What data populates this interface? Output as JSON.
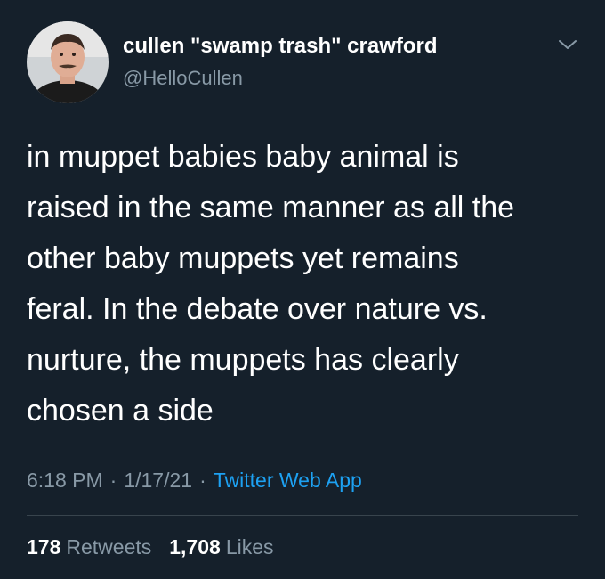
{
  "tweet": {
    "author": {
      "display_name": "cullen \"swamp trash\" crawford",
      "handle": "@HelloCullen",
      "avatar_icon": "user-avatar"
    },
    "menu_icon": "chevron-down-icon",
    "text_lines": [
      "in muppet babies baby animal is",
      "raised in the same manner as all the",
      "other baby muppets yet remains",
      "feral. In the debate over nature vs.",
      "nurture, the muppets has clearly",
      "chosen a side"
    ],
    "time": "6:18 PM",
    "date": "1/17/21",
    "separator": "·",
    "source": "Twitter Web App",
    "retweets": {
      "count": "178",
      "label": "Retweets"
    },
    "likes": {
      "count": "1,708",
      "label": "Likes"
    }
  },
  "colors": {
    "background": "#15202b",
    "text": "#ffffff",
    "muted": "#8899a6",
    "link": "#1da1f2",
    "divider": "#38444d"
  }
}
